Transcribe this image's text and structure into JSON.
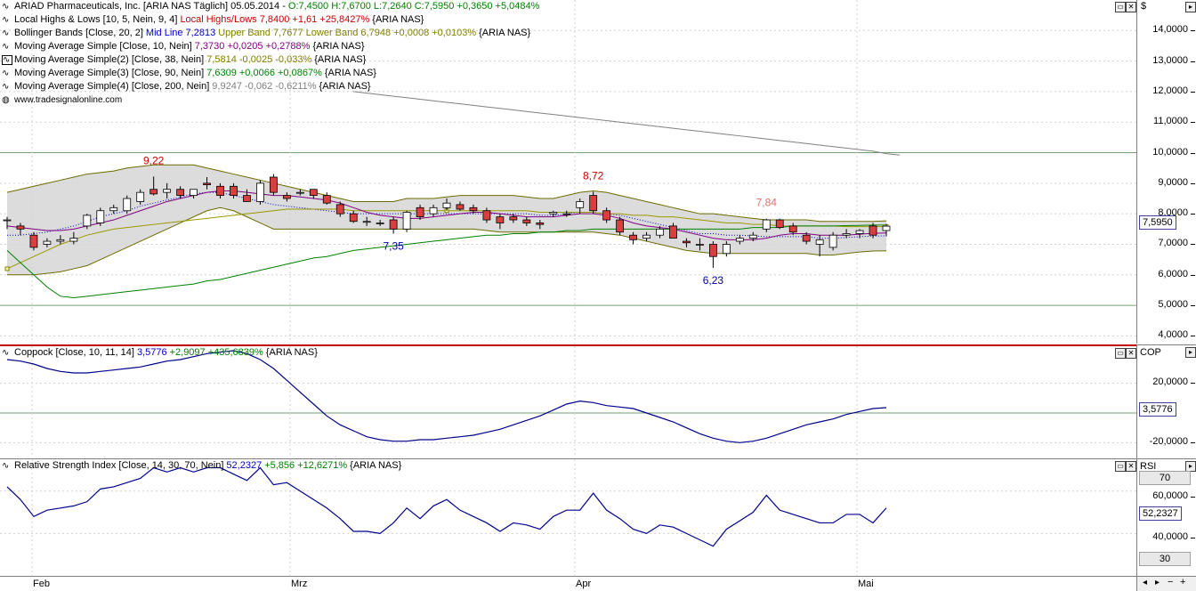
{
  "header": {
    "title": "ARIAD Pharmaceuticals, Inc. [ARIA NAS  Täglich] 05.05.2014 -",
    "ohlc": "O:7,4500 H:7,6700 L:7,2640",
    "close": "C:7,5950 +0,3650 +5,0484%"
  },
  "legend": [
    {
      "label": "Local Highs & Lows [10, 5, Nein, 9, 4]",
      "value": "Local Highs/Lows 7,8400 +1,61 +25,8427%",
      "suffix": "{ARIA NAS}",
      "color": "#cc0000"
    },
    {
      "label": "Bollinger Bands [Close, 20, 2]",
      "value": "Mid Line 7,2813",
      "value2": "Upper Band 7,7677 Lower Band 6,7948 +0,0008 +0,0103%",
      "suffix": "{ARIA NAS}",
      "color": "#0000cc",
      "color2": "#808000"
    },
    {
      "label": "Moving Average Simple [Close, 10, Nein]",
      "value": "7,3730 +0,0205 +0,2788%",
      "suffix": "{ARIA NAS}",
      "color": "#800080"
    },
    {
      "label": "Moving Average Simple(2) [Close, 38, Nein]",
      "value": "7,5814 -0,0025 -0,033%",
      "suffix": "{ARIA NAS}",
      "color": "#808000"
    },
    {
      "label": "Moving Average Simple(3) [Close, 90, Nein]",
      "value": "7,6309 +0,0066 +0,0867%",
      "suffix": "{ARIA NAS}",
      "color": "#008000"
    },
    {
      "label": "Moving Average Simple(4) [Close, 200, Nein]",
      "value": "9,9247 -0,062 -0,6211%",
      "suffix": "{ARIA NAS}",
      "color": "#808080"
    }
  ],
  "watermark": "www.tradesignalonline.com",
  "price_axis": {
    "currency": "$",
    "ticks": [
      "14,0000",
      "13,0000",
      "12,0000",
      "11,0000",
      "10,0000",
      "9,0000",
      "8,0000",
      "7,0000",
      "6,0000",
      "5,0000",
      "4,0000"
    ],
    "current": "7,5950"
  },
  "coppock": {
    "label": "Coppock [Close, 10, 11, 14]",
    "value": "3,5776",
    "change": "+2,9097 +435,6839%",
    "suffix": "{ARIA NAS}",
    "axis_title": "COP",
    "ticks": [
      "20,0000",
      "-20,0000"
    ],
    "current": "3,5776"
  },
  "rsi": {
    "label": "Relative Strength Index [Close, 14, 30, 70, Nein]",
    "value": "52,2327",
    "change": "+5,856 +12,6271%",
    "suffix": "{ARIA NAS}",
    "axis_title": "RSI",
    "ticks": [
      "60,0000",
      "40,0000"
    ],
    "upper": "70",
    "lower": "30",
    "current": "52,2327"
  },
  "x_axis": {
    "labels": [
      "Feb",
      "Mrz",
      "Apr",
      "Mai"
    ]
  },
  "chart_data": {
    "type": "candlestick",
    "price_ylim": [
      3.75,
      15.0
    ],
    "candles": [
      {
        "o": 7.8,
        "h": 7.9,
        "l": 7.5,
        "c": 7.8
      },
      {
        "o": 7.6,
        "h": 7.7,
        "l": 7.3,
        "c": 7.5
      },
      {
        "o": 7.3,
        "h": 7.4,
        "l": 6.8,
        "c": 6.9
      },
      {
        "o": 7.0,
        "h": 7.2,
        "l": 6.9,
        "c": 7.1
      },
      {
        "o": 7.1,
        "h": 7.3,
        "l": 7.0,
        "c": 7.15
      },
      {
        "o": 7.1,
        "h": 7.4,
        "l": 7.0,
        "c": 7.2
      },
      {
        "o": 7.6,
        "h": 8.0,
        "l": 7.5,
        "c": 7.95
      },
      {
        "o": 7.7,
        "h": 8.2,
        "l": 7.6,
        "c": 8.1
      },
      {
        "o": 8.1,
        "h": 8.3,
        "l": 8.0,
        "c": 8.2
      },
      {
        "o": 8.1,
        "h": 8.6,
        "l": 8.0,
        "c": 8.5
      },
      {
        "o": 8.4,
        "h": 8.8,
        "l": 8.3,
        "c": 8.7
      },
      {
        "o": 8.8,
        "h": 9.22,
        "l": 8.6,
        "c": 8.65
      },
      {
        "o": 8.7,
        "h": 9.0,
        "l": 8.5,
        "c": 8.8
      },
      {
        "o": 8.8,
        "h": 8.9,
        "l": 8.5,
        "c": 8.6
      },
      {
        "o": 8.6,
        "h": 8.8,
        "l": 8.5,
        "c": 8.8
      },
      {
        "o": 9.0,
        "h": 9.2,
        "l": 8.8,
        "c": 8.95
      },
      {
        "o": 8.9,
        "h": 9.0,
        "l": 8.5,
        "c": 8.6
      },
      {
        "o": 8.9,
        "h": 9.0,
        "l": 8.5,
        "c": 8.6
      },
      {
        "o": 8.6,
        "h": 8.8,
        "l": 8.4,
        "c": 8.4
      },
      {
        "o": 8.4,
        "h": 9.1,
        "l": 8.3,
        "c": 9.0
      },
      {
        "o": 9.2,
        "h": 9.3,
        "l": 8.6,
        "c": 8.7
      },
      {
        "o": 8.6,
        "h": 8.7,
        "l": 8.4,
        "c": 8.5
      },
      {
        "o": 8.7,
        "h": 8.8,
        "l": 8.6,
        "c": 8.7
      },
      {
        "o": 8.8,
        "h": 8.8,
        "l": 8.5,
        "c": 8.6
      },
      {
        "o": 8.6,
        "h": 8.7,
        "l": 8.3,
        "c": 8.35
      },
      {
        "o": 8.3,
        "h": 8.4,
        "l": 7.9,
        "c": 8.0
      },
      {
        "o": 8.0,
        "h": 8.1,
        "l": 7.7,
        "c": 7.75
      },
      {
        "o": 7.75,
        "h": 7.9,
        "l": 7.6,
        "c": 7.75
      },
      {
        "o": 7.7,
        "h": 7.8,
        "l": 7.6,
        "c": 7.7
      },
      {
        "o": 7.8,
        "h": 7.9,
        "l": 7.35,
        "c": 7.5
      },
      {
        "o": 7.5,
        "h": 8.1,
        "l": 7.4,
        "c": 8.05
      },
      {
        "o": 8.2,
        "h": 8.3,
        "l": 7.8,
        "c": 7.9
      },
      {
        "o": 8.0,
        "h": 8.3,
        "l": 7.9,
        "c": 8.2
      },
      {
        "o": 8.2,
        "h": 8.5,
        "l": 8.1,
        "c": 8.35
      },
      {
        "o": 8.3,
        "h": 8.4,
        "l": 8.1,
        "c": 8.15
      },
      {
        "o": 8.2,
        "h": 8.3,
        "l": 8.0,
        "c": 8.1
      },
      {
        "o": 8.1,
        "h": 8.2,
        "l": 7.7,
        "c": 7.8
      },
      {
        "o": 7.9,
        "h": 8.0,
        "l": 7.5,
        "c": 7.7
      },
      {
        "o": 7.9,
        "h": 8.0,
        "l": 7.7,
        "c": 7.8
      },
      {
        "o": 7.8,
        "h": 7.9,
        "l": 7.6,
        "c": 7.7
      },
      {
        "o": 7.7,
        "h": 7.8,
        "l": 7.5,
        "c": 7.65
      },
      {
        "o": 8.0,
        "h": 8.1,
        "l": 7.9,
        "c": 8.05
      },
      {
        "o": 8.0,
        "h": 8.1,
        "l": 7.9,
        "c": 8.0
      },
      {
        "o": 8.2,
        "h": 8.5,
        "l": 8.0,
        "c": 8.4
      },
      {
        "o": 8.6,
        "h": 8.72,
        "l": 8.0,
        "c": 8.1
      },
      {
        "o": 8.1,
        "h": 8.2,
        "l": 7.7,
        "c": 7.8
      },
      {
        "o": 7.8,
        "h": 7.9,
        "l": 7.3,
        "c": 7.4
      },
      {
        "o": 7.3,
        "h": 7.4,
        "l": 7.0,
        "c": 7.15
      },
      {
        "o": 7.2,
        "h": 7.4,
        "l": 7.1,
        "c": 7.3
      },
      {
        "o": 7.3,
        "h": 7.6,
        "l": 7.2,
        "c": 7.5
      },
      {
        "o": 7.6,
        "h": 7.7,
        "l": 7.2,
        "c": 7.2
      },
      {
        "o": 7.1,
        "h": 7.2,
        "l": 6.9,
        "c": 7.05
      },
      {
        "o": 7.0,
        "h": 7.2,
        "l": 6.8,
        "c": 7.0
      },
      {
        "o": 7.0,
        "h": 7.1,
        "l": 6.23,
        "c": 6.6
      },
      {
        "o": 6.7,
        "h": 7.1,
        "l": 6.6,
        "c": 7.0
      },
      {
        "o": 7.1,
        "h": 7.3,
        "l": 7.0,
        "c": 7.2
      },
      {
        "o": 7.2,
        "h": 7.4,
        "l": 7.1,
        "c": 7.3
      },
      {
        "o": 7.5,
        "h": 7.84,
        "l": 7.4,
        "c": 7.8
      },
      {
        "o": 7.8,
        "h": 7.84,
        "l": 7.5,
        "c": 7.55
      },
      {
        "o": 7.6,
        "h": 7.7,
        "l": 7.3,
        "c": 7.4
      },
      {
        "o": 7.3,
        "h": 7.4,
        "l": 7.0,
        "c": 7.1
      },
      {
        "o": 7.0,
        "h": 7.3,
        "l": 6.6,
        "c": 7.15
      },
      {
        "o": 6.9,
        "h": 7.4,
        "l": 6.8,
        "c": 7.3
      },
      {
        "o": 7.3,
        "h": 7.5,
        "l": 7.2,
        "c": 7.35
      },
      {
        "o": 7.35,
        "h": 7.5,
        "l": 7.2,
        "c": 7.45
      },
      {
        "o": 7.6,
        "h": 7.7,
        "l": 7.2,
        "c": 7.3
      },
      {
        "o": 7.45,
        "h": 7.67,
        "l": 7.26,
        "c": 7.595
      }
    ],
    "local_extremes": [
      {
        "index": 11,
        "value": 9.22,
        "label": "9,22",
        "kind": "high"
      },
      {
        "index": 29,
        "value": 7.35,
        "label": "7,35",
        "kind": "low"
      },
      {
        "index": 44,
        "value": 8.72,
        "label": "8,72",
        "kind": "high"
      },
      {
        "index": 53,
        "value": 6.23,
        "label": "6,23",
        "kind": "low"
      },
      {
        "index": 57,
        "value": 7.84,
        "label": "7,84",
        "kind": "high"
      }
    ],
    "bollinger_upper": [
      8.7,
      8.8,
      8.9,
      9.0,
      9.1,
      9.2,
      9.3,
      9.35,
      9.4,
      9.5,
      9.55,
      9.6,
      9.6,
      9.6,
      9.6,
      9.5,
      9.4,
      9.3,
      9.2,
      9.1,
      9.0,
      8.9,
      8.8,
      8.7,
      8.6,
      8.5,
      8.4,
      8.4,
      8.4,
      8.4,
      8.5,
      8.5,
      8.5,
      8.55,
      8.6,
      8.6,
      8.6,
      8.6,
      8.6,
      8.55,
      8.5,
      8.5,
      8.6,
      8.7,
      8.75,
      8.7,
      8.6,
      8.5,
      8.4,
      8.3,
      8.2,
      8.1,
      8.0,
      8.0,
      7.95,
      7.9,
      7.85,
      7.8,
      7.8,
      7.8,
      7.8,
      7.75,
      7.75,
      7.75,
      7.75,
      7.75,
      7.77
    ],
    "bollinger_lower": [
      6.0,
      6.0,
      6.0,
      6.05,
      6.1,
      6.2,
      6.3,
      6.5,
      6.7,
      6.9,
      7.1,
      7.3,
      7.5,
      7.7,
      7.9,
      8.1,
      8.2,
      8.1,
      7.9,
      7.7,
      7.5,
      7.5,
      7.5,
      7.5,
      7.5,
      7.5,
      7.5,
      7.5,
      7.5,
      7.5,
      7.5,
      7.5,
      7.5,
      7.5,
      7.5,
      7.5,
      7.45,
      7.4,
      7.4,
      7.4,
      7.4,
      7.4,
      7.4,
      7.4,
      7.4,
      7.35,
      7.3,
      7.2,
      7.1,
      7.0,
      6.9,
      6.8,
      6.75,
      6.7,
      6.7,
      6.7,
      6.7,
      6.7,
      6.7,
      6.7,
      6.7,
      6.65,
      6.65,
      6.7,
      6.75,
      6.78,
      6.79
    ],
    "bollinger_mid": [
      7.3,
      7.3,
      7.35,
      7.4,
      7.5,
      7.6,
      7.75,
      7.9,
      8.0,
      8.1,
      8.25,
      8.35,
      8.45,
      8.55,
      8.65,
      8.7,
      8.7,
      8.6,
      8.5,
      8.4,
      8.3,
      8.25,
      8.2,
      8.15,
      8.1,
      8.05,
      8.0,
      8.0,
      8.0,
      8.0,
      8.0,
      8.0,
      8.0,
      8.0,
      8.0,
      8.0,
      8.0,
      8.0,
      8.0,
      8.0,
      7.95,
      7.95,
      8.0,
      8.05,
      8.05,
      8.0,
      7.95,
      7.85,
      7.75,
      7.65,
      7.55,
      7.45,
      7.35,
      7.35,
      7.3,
      7.3,
      7.28,
      7.25,
      7.25,
      7.25,
      7.25,
      7.2,
      7.2,
      7.22,
      7.25,
      7.27,
      7.28
    ],
    "sma10": [
      7.6,
      7.55,
      7.5,
      7.45,
      7.45,
      7.5,
      7.6,
      7.7,
      7.8,
      7.95,
      8.1,
      8.25,
      8.4,
      8.5,
      8.6,
      8.7,
      8.75,
      8.75,
      8.7,
      8.65,
      8.6,
      8.6,
      8.55,
      8.5,
      8.45,
      8.35,
      8.2,
      8.05,
      7.95,
      7.9,
      7.85,
      7.85,
      7.9,
      7.95,
      8.0,
      8.05,
      8.05,
      8.0,
      7.95,
      7.9,
      7.9,
      7.9,
      7.95,
      8.0,
      8.0,
      7.95,
      7.85,
      7.7,
      7.6,
      7.55,
      7.5,
      7.4,
      7.3,
      7.2,
      7.15,
      7.15,
      7.15,
      7.2,
      7.3,
      7.35,
      7.35,
      7.3,
      7.3,
      7.3,
      7.33,
      7.36,
      7.37
    ],
    "sma38": [
      6.2,
      6.4,
      6.6,
      6.8,
      7.0,
      7.15,
      7.3,
      7.4,
      7.5,
      7.55,
      7.6,
      7.65,
      7.7,
      7.75,
      7.8,
      7.85,
      7.9,
      7.95,
      8.0,
      8.05,
      8.1,
      8.15,
      8.15,
      8.15,
      8.15,
      8.15,
      8.1,
      8.1,
      8.1,
      8.1,
      8.1,
      8.1,
      8.1,
      8.1,
      8.1,
      8.1,
      8.1,
      8.1,
      8.1,
      8.1,
      8.05,
      8.05,
      8.05,
      8.05,
      8.05,
      8.0,
      8.0,
      7.95,
      7.95,
      7.9,
      7.9,
      7.85,
      7.8,
      7.75,
      7.7,
      7.7,
      7.65,
      7.65,
      7.6,
      7.6,
      7.6,
      7.6,
      7.6,
      7.58,
      7.58,
      7.58,
      7.58
    ],
    "sma90": [
      6.8,
      6.4,
      6.0,
      5.6,
      5.3,
      5.25,
      5.3,
      5.35,
      5.4,
      5.45,
      5.5,
      5.55,
      5.6,
      5.65,
      5.7,
      5.8,
      5.85,
      5.95,
      6.05,
      6.15,
      6.25,
      6.35,
      6.45,
      6.55,
      6.6,
      6.7,
      6.8,
      6.85,
      6.9,
      6.95,
      7.0,
      7.05,
      7.1,
      7.15,
      7.2,
      7.25,
      7.3,
      7.3,
      7.35,
      7.35,
      7.4,
      7.4,
      7.45,
      7.45,
      7.5,
      7.5,
      7.5,
      7.5,
      7.5,
      7.5,
      7.5,
      7.5,
      7.5,
      7.5,
      7.5,
      7.5,
      7.55,
      7.55,
      7.55,
      7.6,
      7.6,
      7.6,
      7.6,
      7.61,
      7.62,
      7.63,
      7.63
    ],
    "sma200_start_index": 26,
    "sma200": [
      12.0,
      11.95,
      11.9,
      11.85,
      11.8,
      11.75,
      11.7,
      11.65,
      11.6,
      11.55,
      11.5,
      11.45,
      11.4,
      11.35,
      11.3,
      11.25,
      11.2,
      11.15,
      11.1,
      11.05,
      11.0,
      10.95,
      10.9,
      10.85,
      10.8,
      10.75,
      10.7,
      10.65,
      10.6,
      10.55,
      10.5,
      10.45,
      10.4,
      10.35,
      10.3,
      10.25,
      10.2,
      10.15,
      10.1,
      10.05,
      9.97,
      9.92
    ],
    "coppock_ylim": [
      -30,
      45
    ],
    "coppock": [
      36,
      35,
      33,
      30,
      28,
      27,
      27,
      28,
      29,
      30,
      31,
      33,
      35,
      36,
      38,
      40,
      41,
      42,
      40,
      36,
      30,
      22,
      14,
      6,
      -2,
      -8,
      -12,
      -16,
      -18,
      -19,
      -19,
      -18,
      -18,
      -17,
      -16,
      -15,
      -13,
      -11,
      -8,
      -5,
      -2,
      2,
      6,
      8,
      7,
      5,
      4,
      3,
      0,
      -3,
      -6,
      -10,
      -14,
      -17,
      -19,
      -20,
      -19,
      -17,
      -14,
      -11,
      -8,
      -6,
      -4,
      -1,
      1,
      3,
      3.58
    ],
    "rsi_ylim": [
      20,
      75
    ],
    "rsi": [
      62,
      56,
      48,
      51,
      52,
      53,
      55,
      61,
      62,
      64,
      66,
      71,
      69,
      71,
      69,
      71,
      71,
      68,
      65,
      71,
      63,
      64,
      60,
      56,
      52,
      47,
      41,
      41,
      40,
      45,
      52,
      47,
      53,
      56,
      51,
      48,
      45,
      41,
      45,
      44,
      42,
      48,
      51,
      51,
      59,
      51,
      47,
      42,
      40,
      44,
      43,
      40,
      37,
      34,
      42,
      46,
      50,
      58,
      51,
      49,
      47,
      45,
      45,
      49,
      49,
      45,
      52
    ]
  }
}
